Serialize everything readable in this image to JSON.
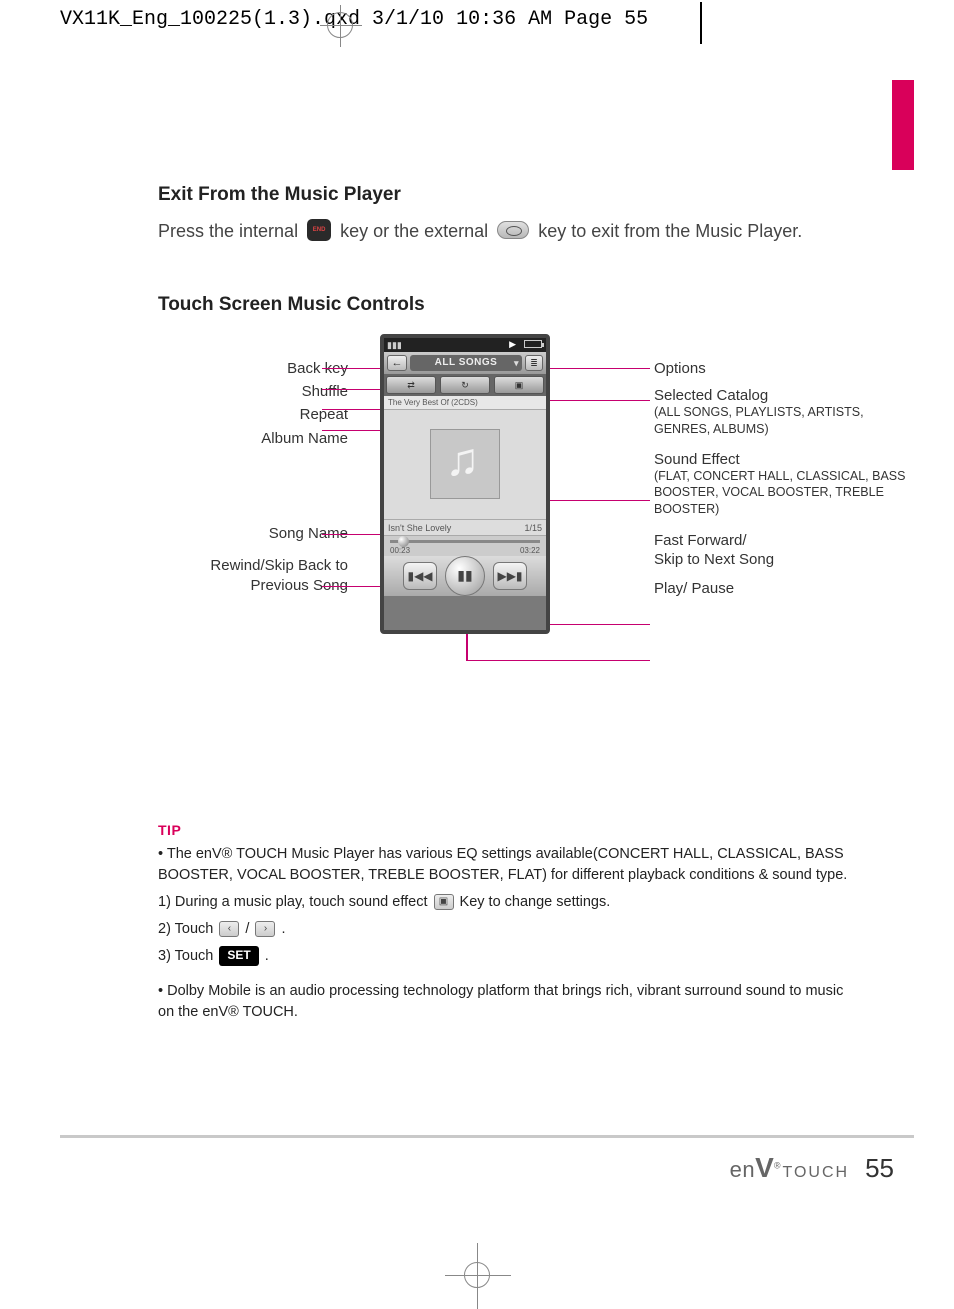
{
  "header": {
    "crop_text": "VX11K_Eng_100225(1.3).qxd  3/1/10  10:36 AM  Page 55"
  },
  "section1": {
    "title": "Exit From the Music Player",
    "text_a": "Press the internal ",
    "text_b": " key or the external ",
    "text_c": " key to exit from the Music Player.",
    "end_key_label": "END"
  },
  "section2": {
    "title": "Touch Screen Music Controls"
  },
  "diagram": {
    "left": {
      "back": "Back key",
      "shuffle": "Shuffle",
      "repeat": "Repeat",
      "album": "Album Name",
      "song": "Song Name",
      "rewind_a": "Rewind/Skip Back to",
      "rewind_b": "Previous Song"
    },
    "right": {
      "options": "Options",
      "catalog": "Selected Catalog",
      "catalog_sub": "(ALL SONGS, PLAYLISTS, ARTISTS, GENRES, ALBUMS)",
      "sound": "Sound Effect",
      "sound_sub": "(FLAT, CONCERT HALL, CLASSICAL, BASS BOOSTER, VOCAL BOOSTER, TREBLE BOOSTER)",
      "ffwd_a": "Fast Forward/",
      "ffwd_b": "Skip to Next Song",
      "play": "Play/ Pause"
    },
    "phone": {
      "title": "ALL SONGS",
      "album": "The Very Best Of (2CDS)",
      "song": "Isn't She Lovely",
      "track": "1/15",
      "t_elapsed": "00:23",
      "t_total": "03:22",
      "shuffle_glyph": "⇄",
      "repeat_glyph": "↻",
      "dolby_glyph": "▣",
      "back_glyph": "←",
      "opt_glyph": "≣",
      "prev_glyph": "▮◀◀",
      "pause_glyph": "▮▮",
      "next_glyph": "▶▶▮"
    }
  },
  "tip": {
    "label": "TIP",
    "bullet1": "• The enV® TOUCH Music Player has various EQ settings available(CONCERT HALL, CLASSICAL, BASS BOOSTER, VOCAL BOOSTER, TREBLE BOOSTER, FLAT) for different playback conditions & sound type.",
    "step1_a": "1) During a music play, touch sound effect ",
    "step1_b": " Key to change settings.",
    "step2_a": "2) Touch ",
    "step2_mid": " / ",
    "step2_b": " .",
    "left_glyph": "‹",
    "right_glyph": "›",
    "dolby_glyph": "▣",
    "step3_a": "3) Touch ",
    "step3_b": " .",
    "set_label": "SET",
    "bullet2": "• Dolby Mobile is an audio processing technology platform that brings rich, vibrant surround sound to music on the enV® TOUCH."
  },
  "footer": {
    "brand_en": "en",
    "brand_v": "V",
    "brand_reg": "®",
    "brand_touch": "TOUCH",
    "page": "55"
  }
}
